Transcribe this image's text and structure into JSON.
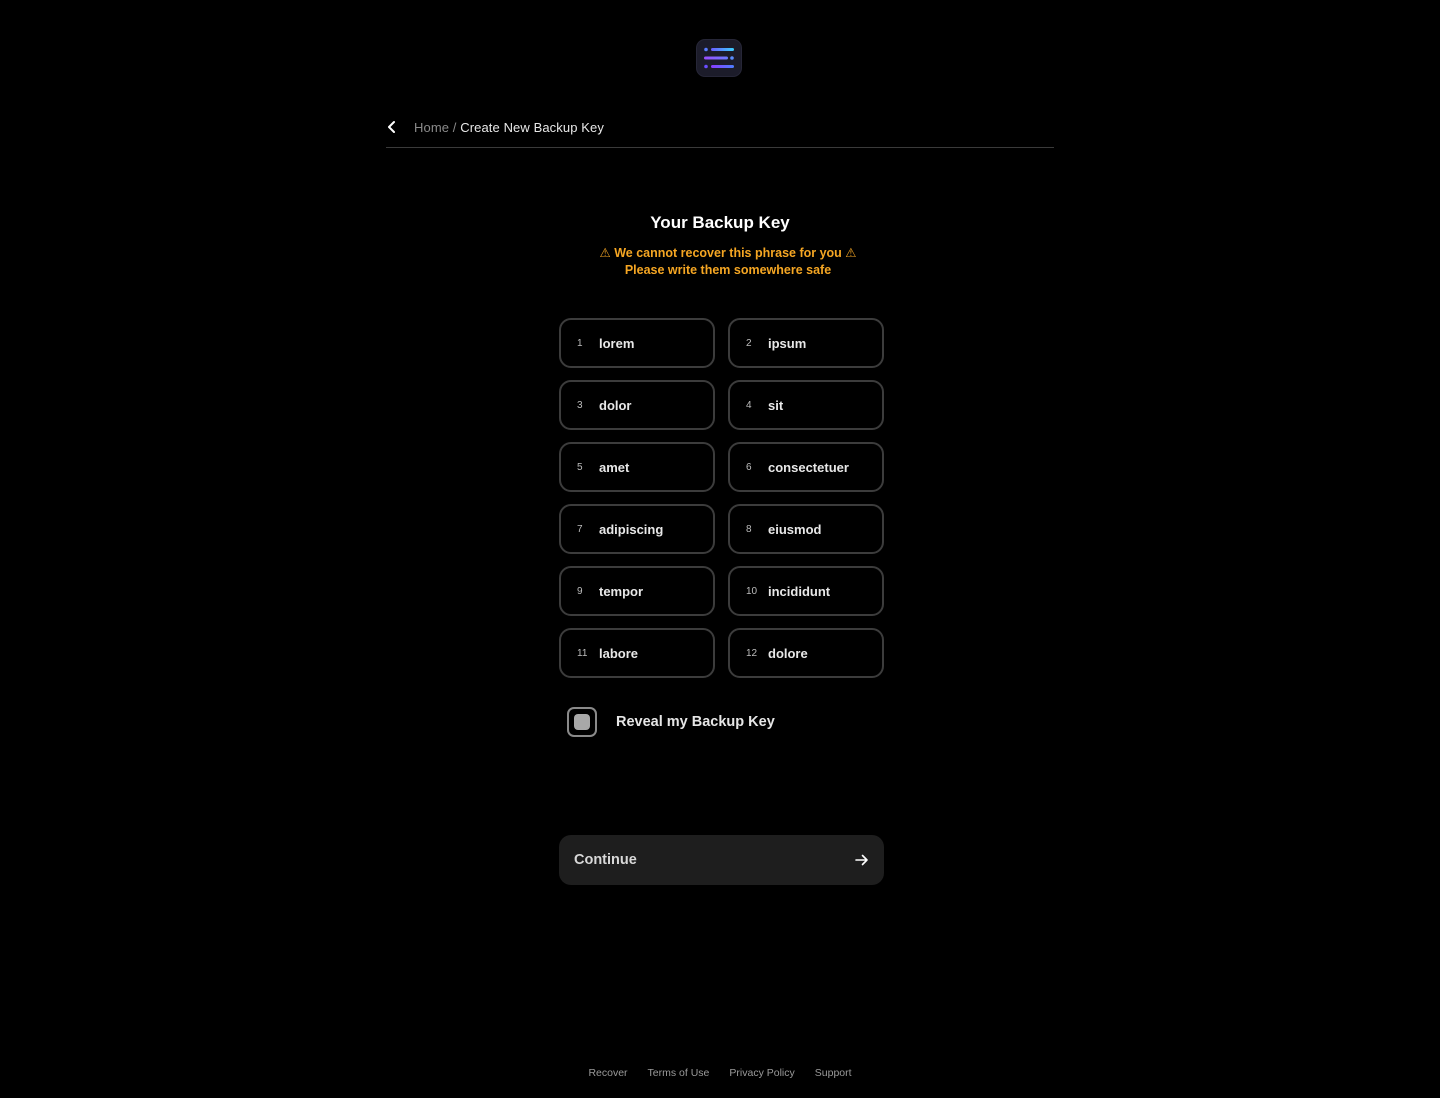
{
  "header": {
    "logo_icon": "menu-lines-logo-icon"
  },
  "breadcrumb": {
    "back_icon": "chevron-left-icon",
    "home": "Home",
    "separator": "/",
    "current": "Create New Backup Key"
  },
  "main": {
    "title": "Your Backup Key",
    "warning_line1": "⚠ We cannot recover this phrase for you ⚠",
    "warning_line2": "Please write them somewhere safe",
    "warning_color": "#f5a623",
    "words": [
      {
        "num": "1",
        "word": "lorem"
      },
      {
        "num": "2",
        "word": "ipsum"
      },
      {
        "num": "3",
        "word": "dolor"
      },
      {
        "num": "4",
        "word": "sit"
      },
      {
        "num": "5",
        "word": "amet"
      },
      {
        "num": "6",
        "word": "consectetuer"
      },
      {
        "num": "7",
        "word": "adipiscing"
      },
      {
        "num": "8",
        "word": "eiusmod"
      },
      {
        "num": "9",
        "word": "tempor"
      },
      {
        "num": "10",
        "word": "incididunt"
      },
      {
        "num": "11",
        "word": "labore"
      },
      {
        "num": "12",
        "word": "dolore"
      }
    ],
    "reveal_label": "Reveal my Backup Key",
    "reveal_checked": false,
    "continue_label": "Continue",
    "continue_icon": "arrow-right-icon"
  },
  "footer": {
    "links": [
      "Recover",
      "Terms of Use",
      "Privacy Policy",
      "Support"
    ]
  }
}
